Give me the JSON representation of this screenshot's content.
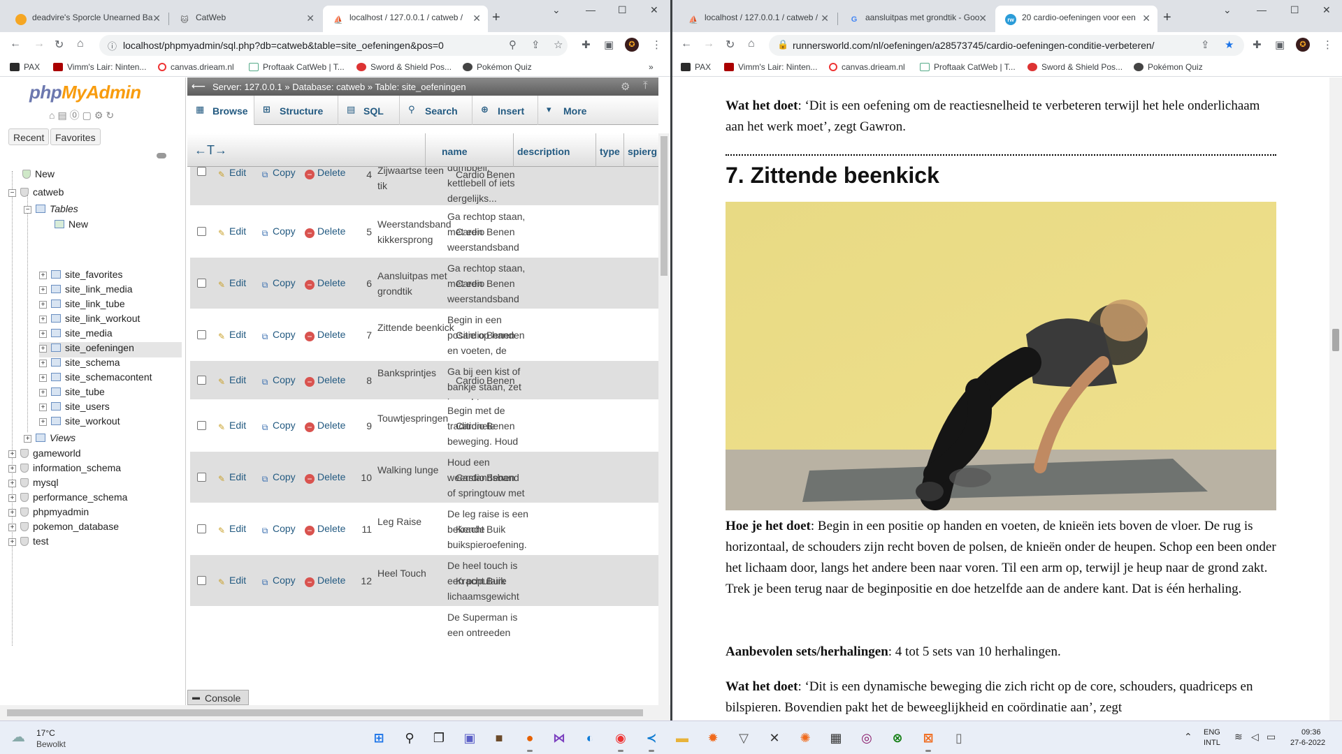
{
  "left_browser": {
    "tabs": [
      {
        "title": "deadvire's Sporcle Unearned Ba",
        "active": false
      },
      {
        "title": "CatWeb",
        "active": false
      },
      {
        "title": "localhost / 127.0.0.1 / catweb /",
        "active": true
      }
    ],
    "url": "localhost/phpmyadmin/sql.php?db=catweb&table=site_oefeningen&pos=0"
  },
  "right_browser": {
    "tabs": [
      {
        "title": "localhost / 127.0.0.1 / catweb /",
        "active": false
      },
      {
        "title": "aansluitpas met grondtik - Goo",
        "active": false
      },
      {
        "title": "20 cardio-oefeningen voor een",
        "active": true
      }
    ],
    "url": "runnersworld.com/nl/oefeningen/a28573745/cardio-oefeningen-conditie-verbeteren/"
  },
  "bookmarks": [
    "PAX",
    "Vimm's Lair: Ninten...",
    "canvas.drieam.nl",
    "Proftaak CatWeb | T...",
    "Sword & Shield Pos...",
    "Pokémon Quiz"
  ],
  "pma": {
    "logo_a": "php",
    "logo_b": "MyAdmin",
    "recent": "Recent",
    "favorites": "Favorites",
    "tree": {
      "new": "New",
      "catweb": "catweb",
      "tables": "Tables",
      "tables_new": "New",
      "tables_list": [
        "site_favorites",
        "site_link_media",
        "site_link_tube",
        "site_link_workout",
        "site_media",
        "site_oefeningen",
        "site_schema",
        "site_schemacontent",
        "site_tube",
        "site_users",
        "site_workout"
      ],
      "views": "Views",
      "databases": [
        "gameworld",
        "information_schema",
        "mysql",
        "performance_schema",
        "phpmyadmin",
        "pokemon_database",
        "test"
      ]
    },
    "breadcrumb": {
      "server": "Server: 127.0.0.1",
      "database": "Database: catweb",
      "table": "Table: site_oefeningen"
    },
    "tabs": [
      "Browse",
      "Structure",
      "SQL",
      "Search",
      "Insert",
      "More"
    ],
    "columns": {
      "arrows": "←T→",
      "name": "name",
      "description": "description",
      "type": "type",
      "spier": "spierg"
    },
    "actions": {
      "edit": "Edit",
      "copy": "Copy",
      "delete": "Delete"
    },
    "partial_top": {
      "id": "4",
      "name": "Zijwaartse teen tik",
      "desc": "dumbbell, kettlebell of iets dergelijks...",
      "type": "Cardio",
      "spier": "Benen"
    },
    "rows": [
      {
        "id": "5",
        "name": "Weerstandsband kikkersprong",
        "desc": "Ga rechtop staan, met een weerstandsband op spanni...",
        "type": "Cardio",
        "spier": "Benen"
      },
      {
        "id": "6",
        "name": "Aansluitpas met grondtik",
        "desc": "Ga rechtop staan, met een weerstandsband op spanni...",
        "type": "Cardio",
        "spier": "Benen"
      },
      {
        "id": "7",
        "name": "Zittende beenkick",
        "desc": "Begin in een positie op handen en voeten, de knieë...",
        "type": "Cardio",
        "spier": "Benen"
      },
      {
        "id": "8",
        "name": "Banksprintjes",
        "desc": "Ga bij een kist of bankje staan, zet je rechtervoe...",
        "type": "Cardio",
        "spier": "Benen"
      },
      {
        "id": "9",
        "name": "Touwtjespringen",
        "desc": "Begin met de traditionele beweging. Houd de ellebo...",
        "type": "Cardio",
        "spier": "Benen"
      },
      {
        "id": "10",
        "name": "Walking lunge",
        "desc": "Houd een weerstandsband of springtouw met beide ha...",
        "type": "Cardio",
        "spier": "Benen"
      },
      {
        "id": "11",
        "name": "Leg Raise",
        "desc": "De leg raise is een bekende buikspieroefening. Het...",
        "type": "Kracht",
        "spier": "Buik"
      },
      {
        "id": "12",
        "name": "Heel Touch",
        "desc": "De heel touch is een populaire lichaamsgewicht oef...",
        "type": "Kracht",
        "spier": "Buik"
      }
    ],
    "partial_bottom": {
      "desc": "De Superman is een ontreeden"
    },
    "console": "Console"
  },
  "article": {
    "p1_bold": "Wat het doet",
    "p1_text": ": ‘Dit is een oefening om de reactiesnelheid te verbeteren terwijl het hele onderlichaam aan het werk moet’, zegt Gawron.",
    "heading": "7. Zittende beenkick",
    "p2_bold": "Hoe je het doet",
    "p2_text": ": Begin in een positie op handen en voeten, de knieën iets boven de vloer. De rug is horizontaal, de schouders zijn recht boven de polsen, de knieën onder de heupen. Schop een been onder het lichaam door, langs het andere been naar voren. Til een arm op, terwijl je heup naar de grond zakt. Trek je been terug naar de beginpositie en doe hetzelfde aan de andere kant. Dat is één herhaling.",
    "p3_bold": "Aanbevolen sets/herhalingen",
    "p3_text": ": 4 tot 5 sets van 10 herhalingen.",
    "p4_bold": "Wat het doet",
    "p4_text": ": ‘Dit is een dynamische beweging die zich richt op de core, schouders, quadriceps en bilspieren. Bovendien pakt het de beweeglijkheid en coördinatie aan’, zegt"
  },
  "taskbar": {
    "weather_temp": "17°C",
    "weather_text": "Bewolkt",
    "lang1": "ENG",
    "lang2": "INTL",
    "time": "09:36",
    "date": "27-6-2022"
  }
}
